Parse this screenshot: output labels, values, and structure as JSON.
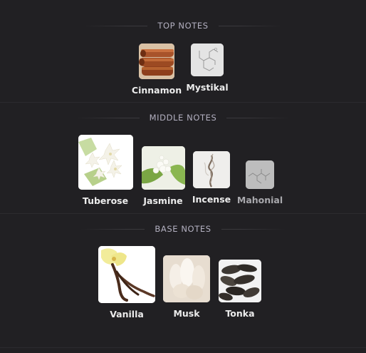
{
  "sections": {
    "top": {
      "title": "TOP NOTES",
      "notes": [
        {
          "label": "Cinnamon",
          "icon": "cinnamon-image"
        },
        {
          "label": "Mystikal",
          "icon": "molecule-image"
        }
      ]
    },
    "middle": {
      "title": "MIDDLE NOTES",
      "notes": [
        {
          "label": "Tuberose",
          "icon": "tuberose-image"
        },
        {
          "label": "Jasmine",
          "icon": "jasmine-image"
        },
        {
          "label": "Incense",
          "icon": "incense-image"
        },
        {
          "label": "Mahonial",
          "icon": "molecule-image"
        }
      ]
    },
    "base": {
      "title": "BASE NOTES",
      "notes": [
        {
          "label": "Vanilla",
          "icon": "vanilla-image"
        },
        {
          "label": "Musk",
          "icon": "musk-image"
        },
        {
          "label": "Tonka",
          "icon": "tonka-image"
        }
      ]
    }
  },
  "colors": {
    "background": "#212023",
    "title": "#b3b0c0",
    "label": "#ececec"
  }
}
